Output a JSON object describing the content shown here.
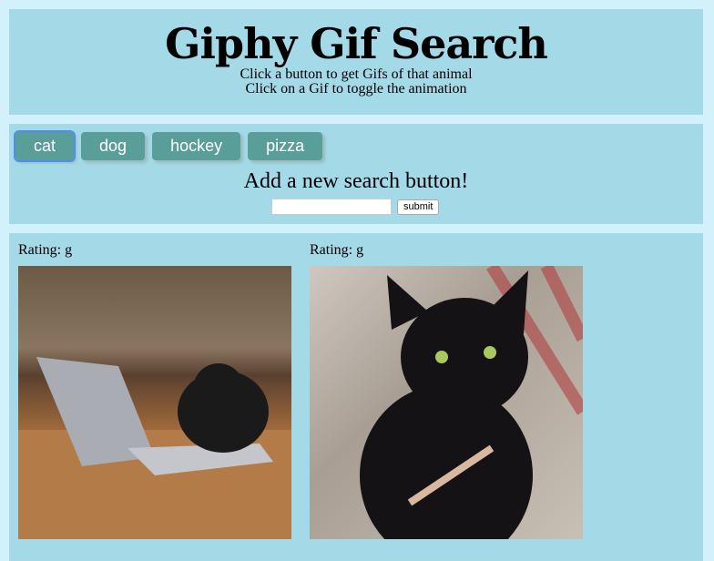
{
  "header": {
    "title": "Giphy Gif Search",
    "line1": "Click a button to get Gifs of that animal",
    "line2": "Click on a Gif to toggle the animation"
  },
  "buttons": [
    "cat",
    "dog",
    "hockey",
    "pizza"
  ],
  "add": {
    "label": "Add a new search button!",
    "input_value": "",
    "submit": "submit"
  },
  "results": [
    {
      "rating": "Rating: g",
      "alt": "cat typing on laptop"
    },
    {
      "rating": "Rating: g",
      "alt": "black cat with nail file"
    }
  ]
}
